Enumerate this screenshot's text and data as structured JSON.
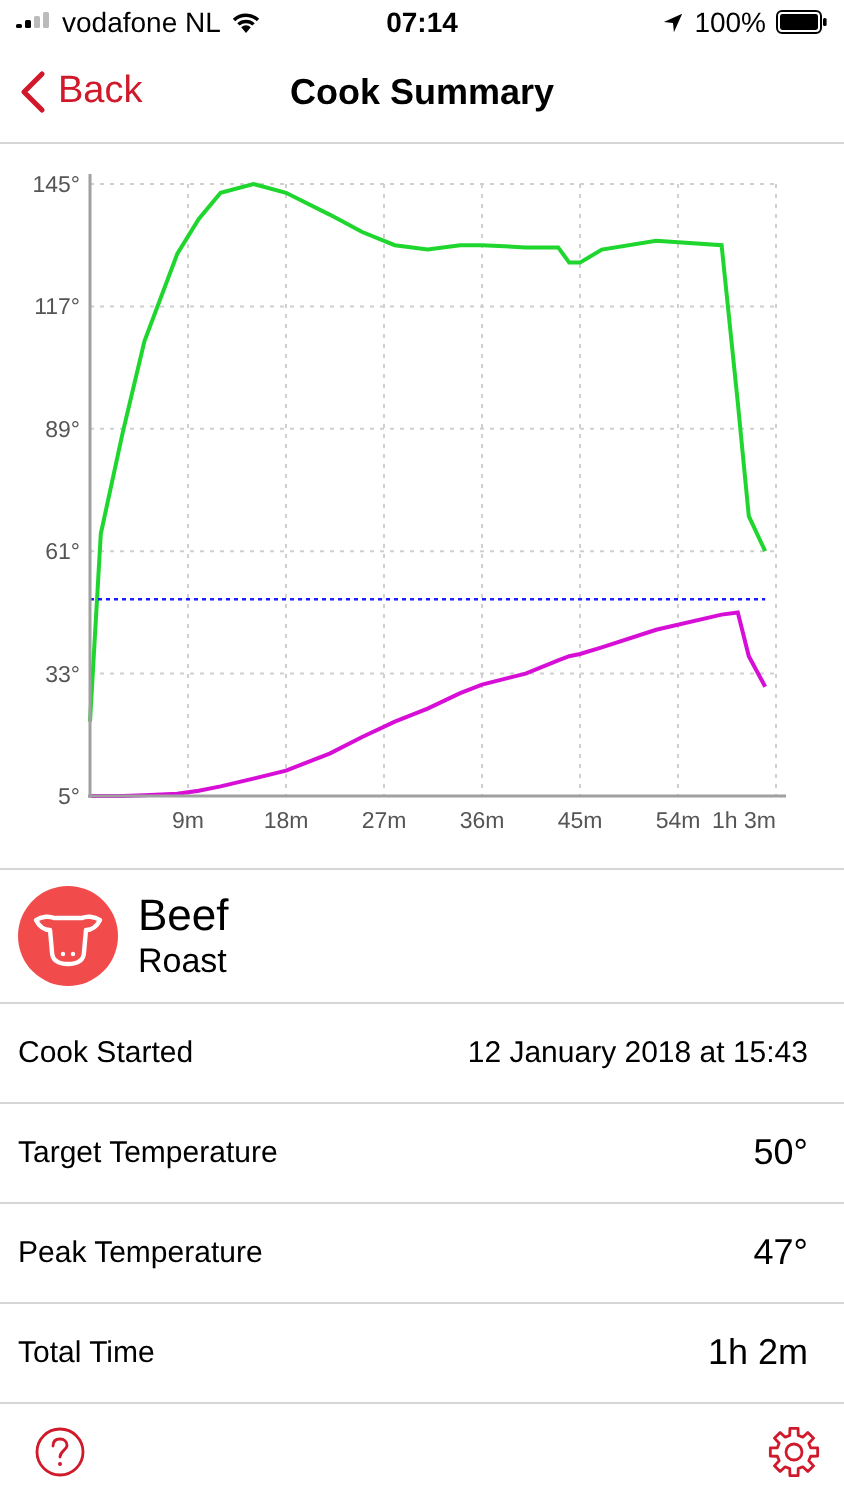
{
  "status_bar": {
    "carrier": "vodafone NL",
    "time": "07:14",
    "battery": "100%"
  },
  "nav": {
    "back": "Back",
    "title": "Cook Summary"
  },
  "chart": {
    "chart_data": {
      "type": "line",
      "x": [
        0,
        1,
        3,
        5,
        8,
        10,
        12,
        15,
        18,
        22,
        25,
        28,
        31,
        34,
        36,
        40,
        43,
        44,
        45,
        47,
        52,
        58,
        59.5,
        60.5,
        62
      ],
      "series": [
        {
          "color": "#1ed62e",
          "line_style": "solid",
          "values": [
            22,
            65,
            88,
            109,
            129,
            137,
            143,
            145,
            143,
            138,
            134,
            131,
            130,
            131,
            131,
            130.5,
            130.5,
            127,
            127,
            130,
            132,
            131,
            95,
            69,
            61
          ]
        },
        {
          "color": "#d60ed6",
          "line_style": "solid",
          "values": [
            5,
            5,
            5,
            5.2,
            5.5,
            6.2,
            7.2,
            9,
            10.8,
            14.7,
            18.5,
            22,
            25,
            28.5,
            30.5,
            33,
            36,
            37,
            37.5,
            39,
            43,
            46.5,
            47,
            37,
            30
          ]
        },
        {
          "color": "#1a1aff",
          "line_style": "dotted",
          "values": [
            50,
            50,
            50,
            50,
            50,
            50,
            50,
            50,
            50,
            50,
            50,
            50,
            50,
            50,
            50,
            50,
            50,
            50,
            50,
            50,
            50,
            50,
            50,
            50,
            50
          ]
        }
      ],
      "xlim": [
        0,
        63
      ],
      "ylim": [
        5,
        145
      ],
      "grid": true,
      "xticks": [
        {
          "value": 9,
          "label": "9m"
        },
        {
          "value": 18,
          "label": "18m"
        },
        {
          "value": 27,
          "label": "27m"
        },
        {
          "value": 36,
          "label": "36m"
        },
        {
          "value": 45,
          "label": "45m"
        },
        {
          "value": 54,
          "label": "54m"
        },
        {
          "value": 63,
          "label": "1h 3m"
        }
      ],
      "yticks": [
        {
          "value": 5,
          "label": "5°"
        },
        {
          "value": 33,
          "label": "33°"
        },
        {
          "value": 61,
          "label": "61°"
        },
        {
          "value": 89,
          "label": "89°"
        },
        {
          "value": 117,
          "label": "117°"
        },
        {
          "value": 145,
          "label": "145°"
        }
      ]
    }
  },
  "food": {
    "name": "Beef",
    "cut": "Roast"
  },
  "details": [
    {
      "label": "Cook Started",
      "value": "12 January 2018 at 15:43"
    },
    {
      "label": "Target Temperature",
      "value": "50°"
    },
    {
      "label": "Peak Temperature",
      "value": "47°"
    },
    {
      "label": "Total Time",
      "value": "1h 2m"
    }
  ]
}
